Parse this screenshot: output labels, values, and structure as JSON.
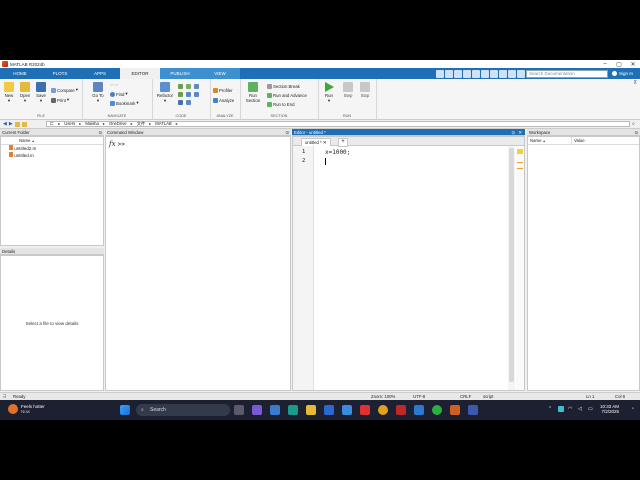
{
  "window": {
    "title": "MATLAB R2024b"
  },
  "tabs": [
    {
      "label": "HOME"
    },
    {
      "label": "PLOTS"
    },
    {
      "label": "APPS"
    },
    {
      "label": "EDITOR"
    },
    {
      "label": "PUBLISH"
    },
    {
      "label": "VIEW"
    }
  ],
  "search": {
    "placeholder": "Search Documentation"
  },
  "signin": {
    "label": "Sign In"
  },
  "ribbon": {
    "file": {
      "label": "FILE",
      "new": "New",
      "open": "Open",
      "save": "Save",
      "compare": "Compare",
      "print": "Print"
    },
    "navigate": {
      "label": "NAVIGATE",
      "goto": "Go To",
      "find": "Find",
      "bookmark": "Bookmark"
    },
    "code": {
      "label": "CODE",
      "refactor": "Refactor"
    },
    "analyze": {
      "label": "ANALYZE",
      "profiler": "Profiler",
      "analyze": "Analyze"
    },
    "section": {
      "label": "SECTION",
      "run_section": "Run Section",
      "section_break": "Section Break",
      "run_advance": "Run and Advance",
      "run_end": "Run to End"
    },
    "run": {
      "label": "RUN",
      "run": "Run",
      "step": "Step",
      "stop": "Stop"
    }
  },
  "address": {
    "path": [
      "C:",
      "Users",
      "Maisha",
      "OneDrive",
      "文件",
      "MATLAB"
    ]
  },
  "current_folder": {
    "title": "Current Folder",
    "col_name": "Name",
    "sort_indicator": "▲",
    "files": [
      {
        "name": "untitled2.m"
      },
      {
        "name": "untitled.m"
      }
    ]
  },
  "details": {
    "title": "Details",
    "message": "Select a file to view details"
  },
  "command_window": {
    "title": "Command Window",
    "prompt": ">>",
    "fx": "fx"
  },
  "editor": {
    "title": "Editor - untitled *",
    "tab_label": "untitled *",
    "add_tab": "+",
    "lines": [
      {
        "num": "1",
        "text": "x=1000;"
      },
      {
        "num": "2",
        "text": ""
      }
    ]
  },
  "workspace": {
    "title": "Workspace",
    "col_name": "Name",
    "col_value": "Value",
    "sort_indicator": "▲"
  },
  "status": {
    "ready": "Ready",
    "zoom": "Zoom: 100%",
    "encoding": "UTF-8",
    "eol": "CRLF",
    "type": "script",
    "ln": "Ln  1",
    "col": "Col  8"
  },
  "taskbar": {
    "weather_line1": "Feels hotter",
    "weather_line2": "Now",
    "search_label": "Search",
    "time": "10:33 AM",
    "date": "7/2/2025"
  },
  "colors": {
    "accent": "#1e6fb6",
    "taskbar": "#1c2030"
  }
}
